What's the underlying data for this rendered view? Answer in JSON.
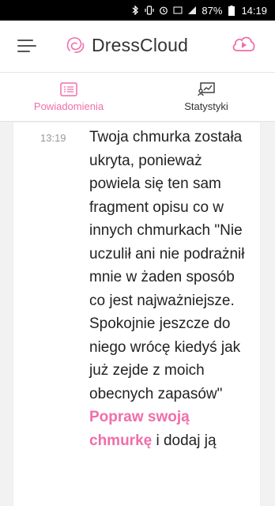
{
  "status_bar": {
    "battery": "87%",
    "time": "14:19"
  },
  "app": {
    "name": "DressCloud",
    "icons": {
      "menu": "hamburger-menu-icon",
      "logo": "dresscloud-logo-icon",
      "cloud": "cloud-play-icon"
    },
    "accent": "#f06ea9"
  },
  "tabs": [
    {
      "label": "Powiadomienia",
      "icon": "notifications-list-icon",
      "active": true
    },
    {
      "label": "Statystyki",
      "icon": "statistics-board-icon",
      "active": false
    }
  ],
  "notification": {
    "time": "13:19",
    "text": "Twoja chmurka została ukryta, ponieważ powiela się ten sam fragment opisu co w innych chmurkach \"Nie uczulił ani nie podrażnił mnie w żaden sposób co jest najważniejsze. Spokojnie jeszcze do niego wrócę kiedyś jak już zejde z moich obecnych zapasów\"",
    "link_text": "Popraw swoją chmurkę",
    "text_after": " i dodaj ją"
  }
}
